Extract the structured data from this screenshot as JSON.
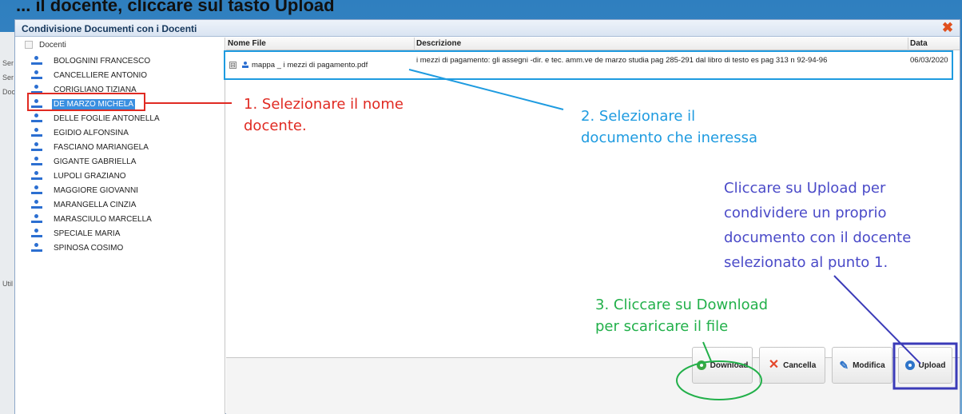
{
  "background": {
    "heading": "... il docente, cliccare sul tasto Upload",
    "side_labels": [
      "Ser",
      "Ser",
      "Doc",
      "Util"
    ]
  },
  "dialog": {
    "title": "Condivisione Documenti con i Docenti",
    "close_icon": "close-icon"
  },
  "tree": {
    "root_label": "Docenti",
    "teachers": [
      "BOLOGNINI FRANCESCO",
      "CANCELLIERE ANTONIO",
      "CORIGLIANO TIZIANA",
      "DE MARZO MICHELA",
      "DELLE FOGLIE ANTONELLA",
      "EGIDIO ALFONSINA",
      "FASCIANO MARIANGELA",
      "GIGANTE GABRIELLA",
      "LUPOLI GRAZIANO",
      "MAGGIORE GIOVANNI",
      "MARANGELLA CINZIA",
      "MARASCIULO MARCELLA",
      "SPECIALE MARIA",
      "SPINOSA COSIMO"
    ],
    "selected": "DE MARZO MICHELA"
  },
  "grid": {
    "headers": {
      "file": "Nome File",
      "description": "Descrizione",
      "date": "Data"
    },
    "rows": [
      {
        "expander": "⊟",
        "file": "mappa _ i mezzi di pagamento.pdf",
        "description": "i mezzi di pagamento: gli assegni -dir. e tec. amm.ve de marzo studia pag 285-291 dal libro di testo es pag 313 n 92-94-96",
        "date": "06/03/2020"
      }
    ]
  },
  "buttons": {
    "download": "Download",
    "cancel": "Cancella",
    "edit": "Modifica",
    "upload": "Upload"
  },
  "annotations": {
    "step1": [
      "1. Selezionare il nome",
      "docente."
    ],
    "step2": [
      "2. Selezionare il",
      "documento che ineressa"
    ],
    "upload_note": [
      "Cliccare su Upload per",
      "condividere un proprio",
      "documento con il docente",
      "selezionato al punto 1."
    ],
    "step3": [
      "3. Cliccare su Download",
      "per scaricare il file"
    ]
  },
  "colors": {
    "step1": "#e02a22",
    "step2": "#1e9be0",
    "upload_note": "#4a4ac8",
    "step3": "#22b04a",
    "selection": "#3a8fe0"
  }
}
